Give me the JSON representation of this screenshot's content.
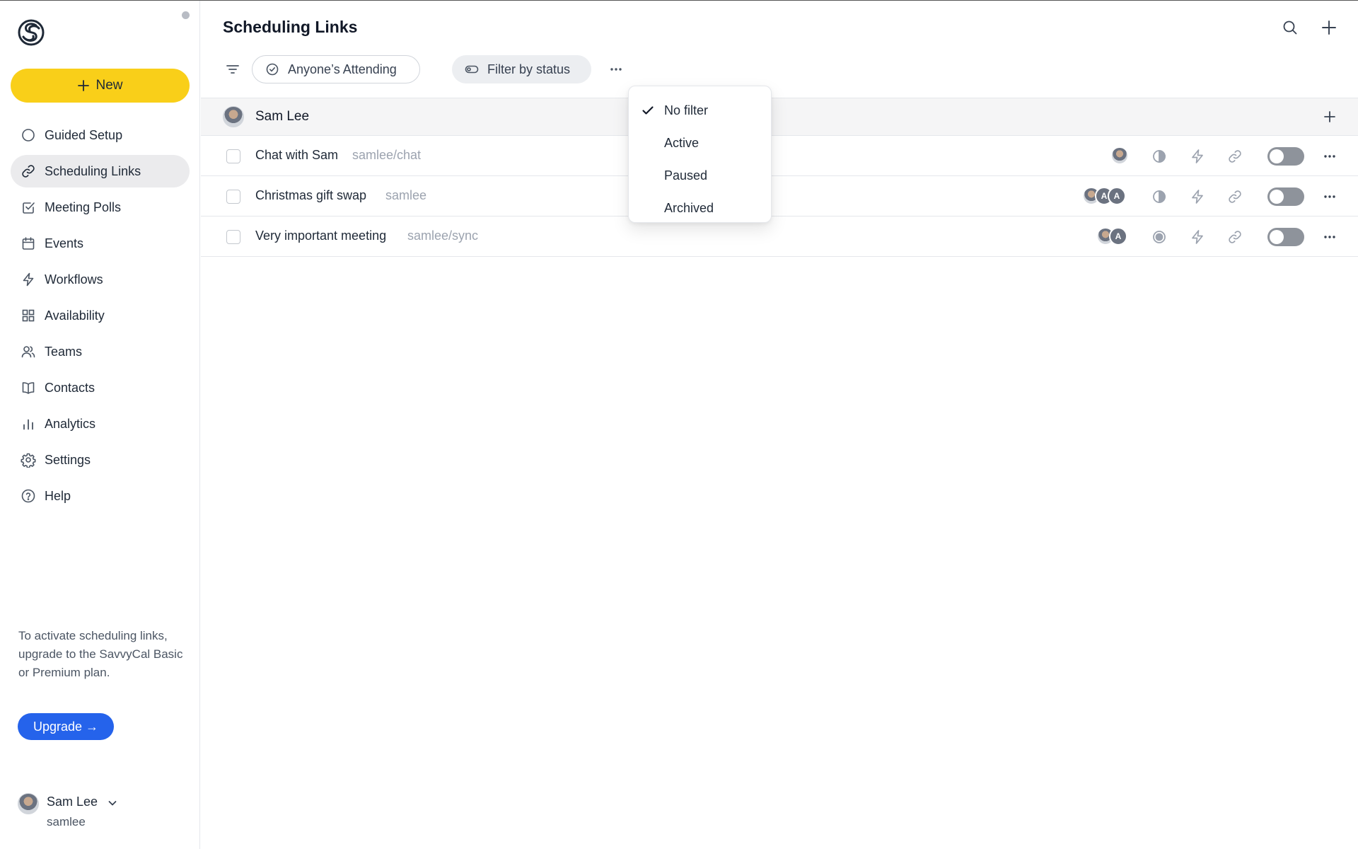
{
  "app": {
    "brand_color": "#f9cf19",
    "accent_color": "#2563eb"
  },
  "sidebar": {
    "new_label": "New",
    "items": [
      {
        "label": "Guided Setup",
        "icon": "circle-icon",
        "active": false
      },
      {
        "label": "Scheduling Links",
        "icon": "link-icon",
        "active": true
      },
      {
        "label": "Meeting Polls",
        "icon": "checkbox-icon",
        "active": false
      },
      {
        "label": "Events",
        "icon": "calendar-icon",
        "active": false
      },
      {
        "label": "Workflows",
        "icon": "lightning-icon",
        "active": false
      },
      {
        "label": "Availability",
        "icon": "grid-icon",
        "active": false
      },
      {
        "label": "Teams",
        "icon": "users-icon",
        "active": false
      },
      {
        "label": "Contacts",
        "icon": "book-icon",
        "active": false
      },
      {
        "label": "Analytics",
        "icon": "bar-chart-icon",
        "active": false
      },
      {
        "label": "Settings",
        "icon": "gear-icon",
        "active": false
      },
      {
        "label": "Help",
        "icon": "help-circle-icon",
        "active": false
      }
    ],
    "promo_text": "To activate scheduling links, upgrade to the SavvyCal Basic or Premium plan.",
    "upgrade_label": "Upgrade →",
    "user": {
      "name": "Sam Lee",
      "handle": "samlee"
    }
  },
  "header": {
    "title": "Scheduling Links"
  },
  "filters": {
    "attending_label": "Anyone’s Attending",
    "status_label": "Filter by status"
  },
  "status_menu": {
    "options": [
      "No filter",
      "Active",
      "Paused",
      "Archived"
    ],
    "selected": "No filter"
  },
  "group": {
    "name": "Sam Lee"
  },
  "links": [
    {
      "name": "Chat with Sam",
      "slug": "samlee/chat",
      "avatars": [
        "photo"
      ],
      "status_icon": "half-circle-icon"
    },
    {
      "name": "Christmas gift swap",
      "slug": "samlee",
      "avatars": [
        "photo",
        "A",
        "A"
      ],
      "status_icon": "half-circle-icon"
    },
    {
      "name": "Very important meeting",
      "slug": "samlee/sync",
      "avatars": [
        "photo",
        "A"
      ],
      "status_icon": "radio-icon"
    }
  ]
}
